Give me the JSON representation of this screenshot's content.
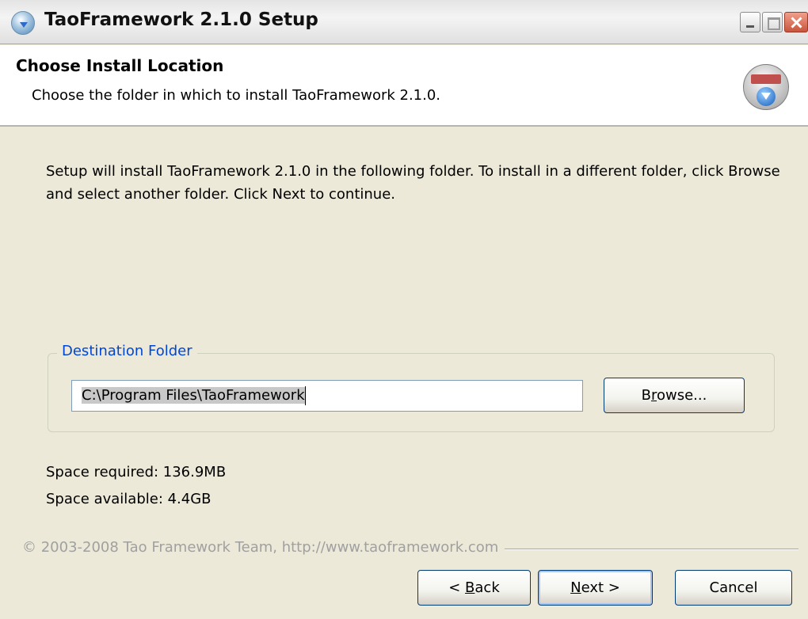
{
  "window": {
    "title": "TaoFramework 2.1.0 Setup"
  },
  "header": {
    "title": "Choose Install Location",
    "subtitle": "Choose the folder in which to install TaoFramework 2.1.0."
  },
  "body": {
    "intro": "Setup will install TaoFramework 2.1.0 in the following folder. To install in a different folder, click Browse and select another folder. Click Next to continue."
  },
  "destination": {
    "legend": "Destination Folder",
    "path": "C:\\Program Files\\TaoFramework",
    "browse_label": "Browse..."
  },
  "space": {
    "required": "Space required: 136.9MB",
    "available": "Space available: 4.4GB"
  },
  "footer": {
    "copyright": "© 2003-2008 Tao Framework Team, http://www.taoframework.com"
  },
  "buttons": {
    "back_label": "< Back",
    "next_label": "Next >",
    "cancel_label": "Cancel"
  }
}
